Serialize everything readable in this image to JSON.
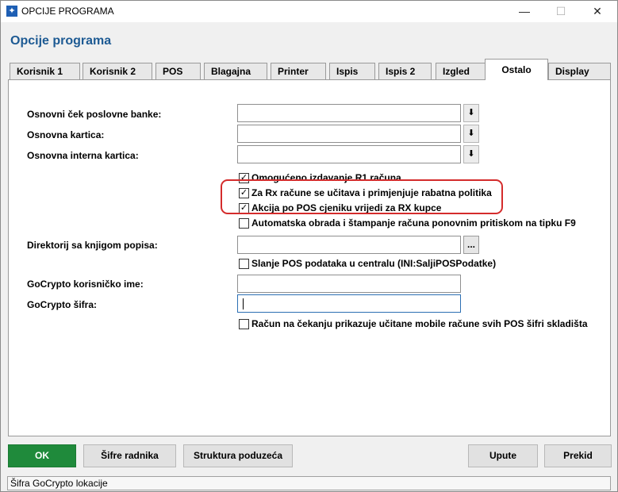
{
  "window": {
    "title": "OPCIJE PROGRAMA",
    "icon": "app-icon",
    "controls": {
      "minimize": "—",
      "maximize": "☐",
      "close": "✕"
    }
  },
  "heading": "Opcije programa",
  "tabs": [
    {
      "label": "Korisnik 1"
    },
    {
      "label": "Korisnik 2"
    },
    {
      "label": "POS"
    },
    {
      "label": "Blagajna"
    },
    {
      "label": "Printer"
    },
    {
      "label": "Ispis"
    },
    {
      "label": "Ispis 2"
    },
    {
      "label": "Izgled"
    },
    {
      "label": "Ostalo",
      "active": true
    },
    {
      "label": "Display"
    }
  ],
  "form": {
    "cek_label": "Osnovni ček poslovne banke:",
    "cek_value": "",
    "kartica_label": "Osnovna kartica:",
    "kartica_value": "",
    "interna_label": "Osnovna interna kartica:",
    "interna_value": "",
    "dropdown_glyph": "⬇",
    "checkboxes": [
      {
        "label": "Omogućeno izdavanje R1 računa",
        "checked": true
      },
      {
        "label": "Za Rx račune se učitava i primjenjuje rabatna politika",
        "checked": true
      },
      {
        "label": "Akcija po POS cjeniku vrijedi za RX kupce",
        "checked": true
      },
      {
        "label": "Automatska obrada i štampanje računa ponovnim pritiskom na tipku F9",
        "checked": false
      }
    ],
    "direktorij_label": "Direktorij sa knjigom popisa:",
    "direktorij_value": "",
    "browse_label": "...",
    "slanje_label": "Slanje POS podataka u centralu (INI:SaljiPOSPodatke)",
    "slanje_checked": false,
    "gocrypto_user_label": "GoCrypto korisničko ime:",
    "gocrypto_user_value": "",
    "gocrypto_pass_label": "GoCrypto šifra:",
    "gocrypto_pass_value": "",
    "cekanje_label": "Račun na čekanju prikazuje učitane mobile račune svih POS šifri skladišta",
    "cekanje_checked": false
  },
  "buttons": {
    "ok": "OK",
    "sifre": "Šifre radnika",
    "struktura": "Struktura poduzeća",
    "upute": "Upute",
    "prekid": "Prekid"
  },
  "status": "Šifra GoCrypto lokacije",
  "colors": {
    "accent": "#1d5a93",
    "ok_button": "#1f8a3b",
    "highlight": "#d42c2c"
  }
}
